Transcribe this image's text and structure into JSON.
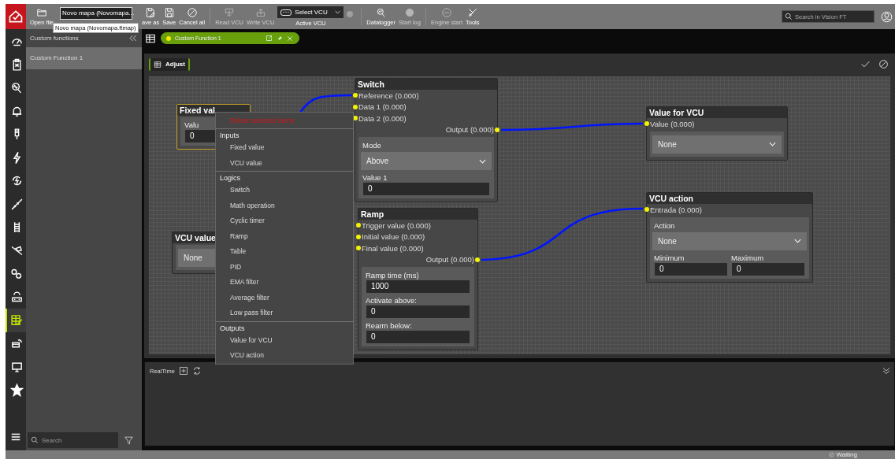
{
  "toolbar": {
    "open_file": {
      "label": "Open file"
    },
    "file_field": {
      "value": "Novo mapa (Novomapa..."
    },
    "tooltip": "Novo mapa (Novomapa.ftmap)",
    "file_buttons": [
      {
        "kind": "save_as",
        "label": "ave as",
        "disabled": false
      },
      {
        "kind": "save",
        "label": "Save",
        "disabled": false
      },
      {
        "kind": "cancel",
        "label": "Cancel all",
        "disabled": false
      }
    ],
    "vcu_buttons": [
      {
        "kind": "read",
        "label": "Read VCU",
        "disabled": true
      },
      {
        "kind": "write",
        "label": "Write VCU",
        "disabled": true
      }
    ],
    "vcu_select": {
      "value": "Select VCU",
      "label": "Active VCU",
      "connected": false
    },
    "log_buttons": [
      {
        "kind": "datalogger",
        "label": "Datalogger",
        "disabled": false
      },
      {
        "kind": "start_log",
        "label": "Start log",
        "disabled": true
      }
    ],
    "engine_buttons": [
      {
        "kind": "engine",
        "label": "Engine start",
        "disabled": true
      },
      {
        "kind": "tools",
        "label": "Tools",
        "disabled": false
      }
    ],
    "search": {
      "placeholder": "Search in Vision FT"
    }
  },
  "rail": [
    {
      "kind": "gauge",
      "selected": false
    },
    {
      "kind": "clipboard",
      "selected": false
    },
    {
      "kind": "analyzer",
      "selected": false
    },
    {
      "kind": "bell",
      "selected": false
    },
    {
      "kind": "plug",
      "selected": false
    },
    {
      "kind": "bolt",
      "selected": false
    },
    {
      "kind": "bolt_cycle",
      "selected": false
    },
    {
      "kind": "diagonal",
      "selected": false
    },
    {
      "kind": "ladder",
      "selected": false
    },
    {
      "kind": "crossed",
      "selected": false
    },
    {
      "kind": "gears",
      "selected": false
    },
    {
      "kind": "gear_car",
      "selected": false
    },
    {
      "kind": "table_edit",
      "selected": true
    },
    {
      "kind": "gear_window",
      "selected": false
    },
    {
      "kind": "monitor",
      "selected": false
    },
    {
      "kind": "star",
      "selected": false
    }
  ],
  "sidebar": {
    "title": "Custom functions",
    "items": [
      {
        "label": "Custom Function 1",
        "selected": true
      }
    ],
    "search": {
      "placeholder": "Search"
    }
  },
  "tabs": [
    {
      "label": "Custom Function 1",
      "selected": true
    }
  ],
  "editor": {
    "title": "Adjust",
    "nodes": [
      {
        "title": "Fixed val",
        "selected": true,
        "fields": [
          {
            "kind": "label",
            "text": "Valu"
          },
          {
            "kind": "input",
            "value": "0"
          }
        ]
      },
      {
        "title": "VCU value",
        "selected": false,
        "fields": [
          {
            "kind": "select",
            "value": "None"
          }
        ]
      },
      {
        "title": "Switch",
        "selected": false,
        "inputs": [
          "Reference (0.000)",
          "Data 1 (0.000)",
          "Data 2 (0.000)"
        ],
        "outputs": [
          "Output (0.000)"
        ],
        "fields": [
          {
            "kind": "label",
            "text": "Mode"
          },
          {
            "kind": "select",
            "value": "Above"
          },
          {
            "kind": "label",
            "text": "Value 1"
          },
          {
            "kind": "input",
            "value": "0"
          }
        ]
      },
      {
        "title": "Ramp",
        "selected": false,
        "inputs": [
          "Trigger value (0.000)",
          "Initial value (0.000)",
          "Final value (0.000)"
        ],
        "outputs": [
          "Output (0.000)"
        ],
        "fields": [
          {
            "kind": "label",
            "text": "Ramp time (ms)"
          },
          {
            "kind": "input",
            "value": "1000"
          },
          {
            "kind": "label",
            "text": "Activate above:"
          },
          {
            "kind": "input",
            "value": "0"
          },
          {
            "kind": "label",
            "text": "Rearm below:"
          },
          {
            "kind": "input",
            "value": "0"
          }
        ]
      },
      {
        "title": "Value for VCU",
        "selected": false,
        "inputs": [
          "Value (0.000)"
        ],
        "fields": [
          {
            "kind": "select",
            "value": "None"
          }
        ]
      },
      {
        "title": "VCU action",
        "selected": false,
        "inputs": [
          "Entrada (0.000)"
        ],
        "fields": [
          {
            "kind": "label",
            "text": "Action"
          },
          {
            "kind": "select",
            "value": "None"
          },
          {
            "kind": "pair",
            "items": [
              {
                "label": "Minimum",
                "value": "0"
              },
              {
                "label": "Maximum",
                "value": "0"
              }
            ]
          }
        ]
      }
    ],
    "context_menu": {
      "delete_label": "Delete selected items",
      "groups": [
        {
          "title": "Inputs",
          "items": [
            "Fixed value",
            "VCU value"
          ]
        },
        {
          "title": "Logics",
          "items": [
            "Switch",
            "Math operation",
            "Cyclic timer",
            "Ramp",
            "Table",
            "PID",
            "EMA filter",
            "Average filter",
            "Low pass filter"
          ]
        },
        {
          "title": "Outputs",
          "items": [
            "Value for VCU",
            "VCU action"
          ]
        }
      ]
    }
  },
  "realtime": {
    "title": "RealTime"
  },
  "status_bar": {
    "status": "Waiting"
  }
}
